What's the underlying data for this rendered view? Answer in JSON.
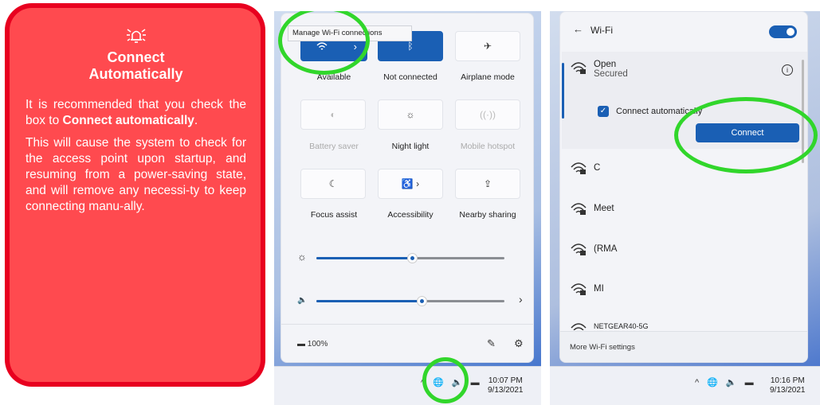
{
  "callout": {
    "title_line1": "Connect",
    "title_line2": "Automatically",
    "p1_a": "It is recommended that you check the box to ",
    "p1_bold": "Connect automatically",
    "p1_end": ".",
    "p2": "This will cause the system to check for the access point upon startup, and resuming from a power-saving state, and will remove any necessi-ty to keep connecting manu-ally."
  },
  "quick": {
    "tooltip": "Manage Wi-Fi connections",
    "tiles": [
      {
        "label": "Available",
        "icon": "wifi-icon"
      },
      {
        "label": "Not connected",
        "icon": "bluetooth-icon"
      },
      {
        "label": "Airplane mode",
        "icon": "airplane-icon"
      },
      {
        "label": "Battery saver",
        "icon": "battery-saver-icon"
      },
      {
        "label": "Night light",
        "icon": "night-light-icon"
      },
      {
        "label": "Mobile hotspot",
        "icon": "hotspot-icon"
      },
      {
        "label": "Focus assist",
        "icon": "moon-icon"
      },
      {
        "label": "Accessibility",
        "icon": "accessibility-icon"
      },
      {
        "label": "Nearby sharing",
        "icon": "share-icon"
      }
    ],
    "brightness": 0.51,
    "volume": 0.56,
    "battery": "100%",
    "time": "10:07 PM",
    "date": "9/13/2021"
  },
  "wifi": {
    "header": "Wi-Fi",
    "open_name": "Open",
    "open_status": "Secured",
    "auto_label": "Connect automatically",
    "connect_label": "Connect",
    "networks": [
      "C",
      "Meet",
      "(RMA",
      "MI",
      "NETGEAR40-5G"
    ],
    "more": "More Wi-Fi settings",
    "time": "10:16 PM",
    "date": "9/13/2021"
  },
  "colors": {
    "accent": "#1a5fb4",
    "highlight": "#31d62b",
    "callout": "#ff4a4f"
  }
}
